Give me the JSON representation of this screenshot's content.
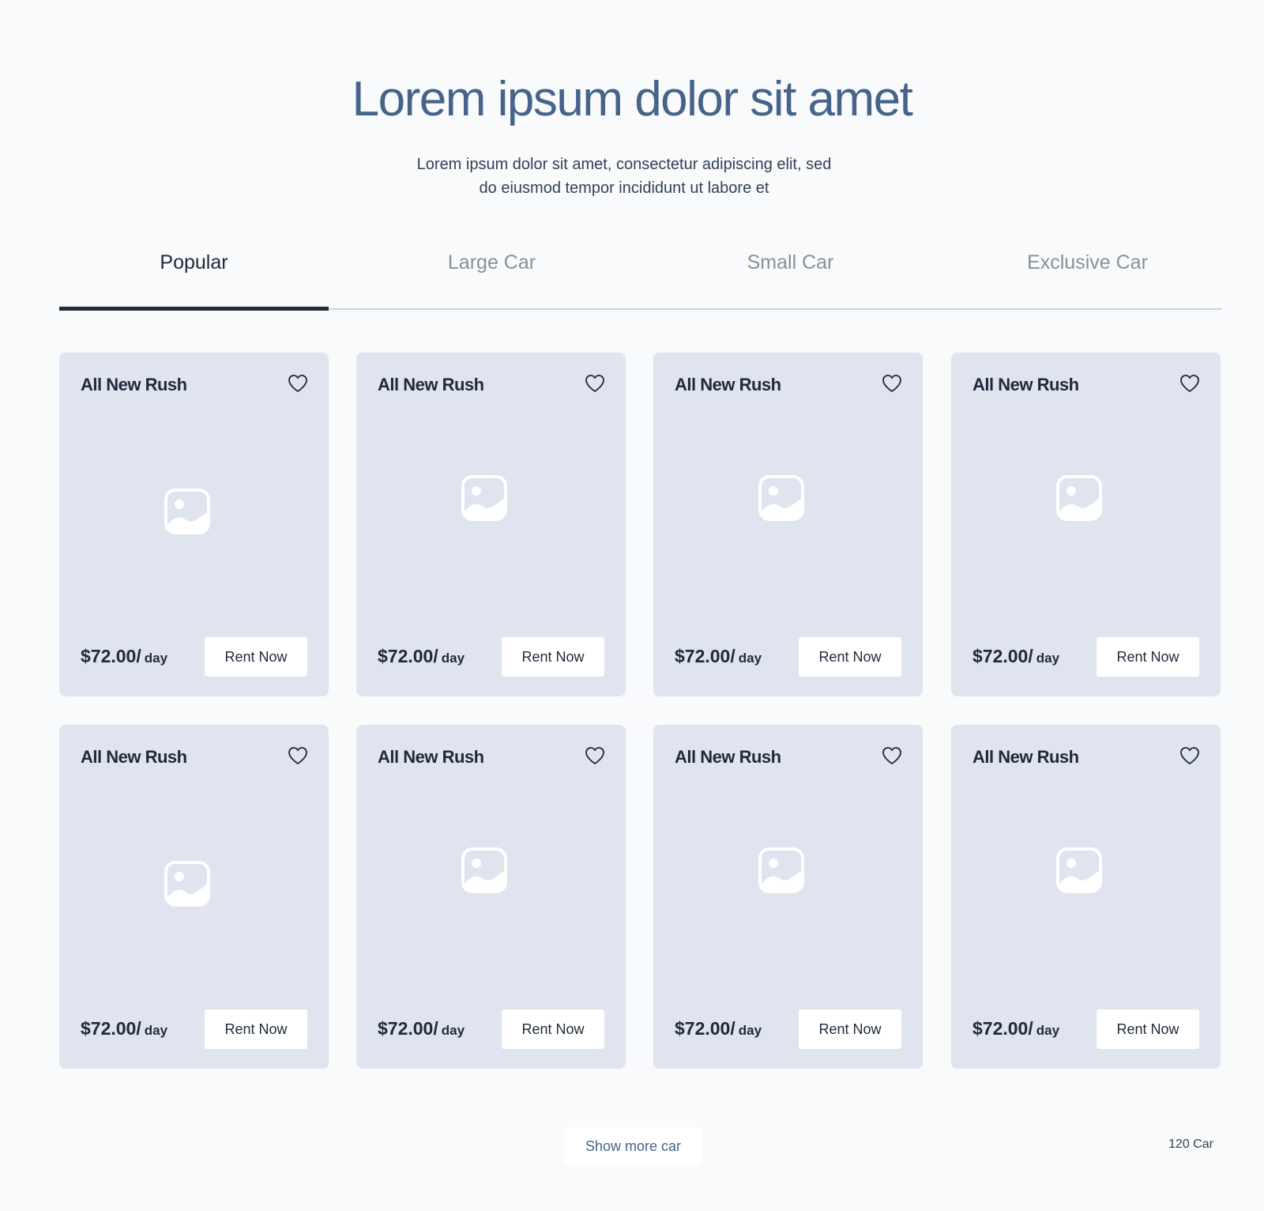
{
  "hero": {
    "title": "Lorem ipsum dolor sit amet",
    "subtitle_line1": "Lorem ipsum dolor sit amet, consectetur adipiscing elit, sed",
    "subtitle_line2": "do eiusmod tempor incididunt ut labore et"
  },
  "tabs": [
    {
      "label": "Popular",
      "active": true
    },
    {
      "label": "Large Car",
      "active": false
    },
    {
      "label": "Small Car",
      "active": false
    },
    {
      "label": "Exclusive Car",
      "active": false
    }
  ],
  "cards": [
    {
      "title": "All New Rush",
      "price": "$72.00/",
      "unit": "day",
      "button": "Rent Now",
      "icon": "heart-outline-icon",
      "image_icon": "image-placeholder-icon"
    },
    {
      "title": "All New Rush",
      "price": "$72.00/",
      "unit": "day",
      "button": "Rent Now",
      "icon": "heart-outline-icon",
      "image_icon": "image-placeholder-icon"
    },
    {
      "title": "All New Rush",
      "price": "$72.00/",
      "unit": "day",
      "button": "Rent Now",
      "icon": "heart-outline-icon",
      "image_icon": "image-placeholder-icon"
    },
    {
      "title": "All New Rush",
      "price": "$72.00/",
      "unit": "day",
      "button": "Rent Now",
      "icon": "heart-outline-icon",
      "image_icon": "image-placeholder-icon"
    },
    {
      "title": "All New Rush",
      "price": "$72.00/",
      "unit": "day",
      "button": "Rent Now",
      "icon": "heart-outline-icon",
      "image_icon": "image-placeholder-icon"
    },
    {
      "title": "All New Rush",
      "price": "$72.00/",
      "unit": "day",
      "button": "Rent Now",
      "icon": "heart-outline-icon",
      "image_icon": "image-placeholder-icon"
    },
    {
      "title": "All New Rush",
      "price": "$72.00/",
      "unit": "day",
      "button": "Rent Now",
      "icon": "heart-outline-icon",
      "image_icon": "image-placeholder-icon"
    },
    {
      "title": "All New Rush",
      "price": "$72.00/",
      "unit": "day",
      "button": "Rent Now",
      "icon": "heart-outline-icon",
      "image_icon": "image-placeholder-icon"
    }
  ],
  "footer": {
    "show_more_label": "Show more car",
    "count_label": "120 Car"
  },
  "colors": {
    "background": "#f8fafc",
    "card": "#dfe4ee",
    "title": "#46638a",
    "text_dark": "#1e293b",
    "tab_inactive": "#8a8f99"
  }
}
